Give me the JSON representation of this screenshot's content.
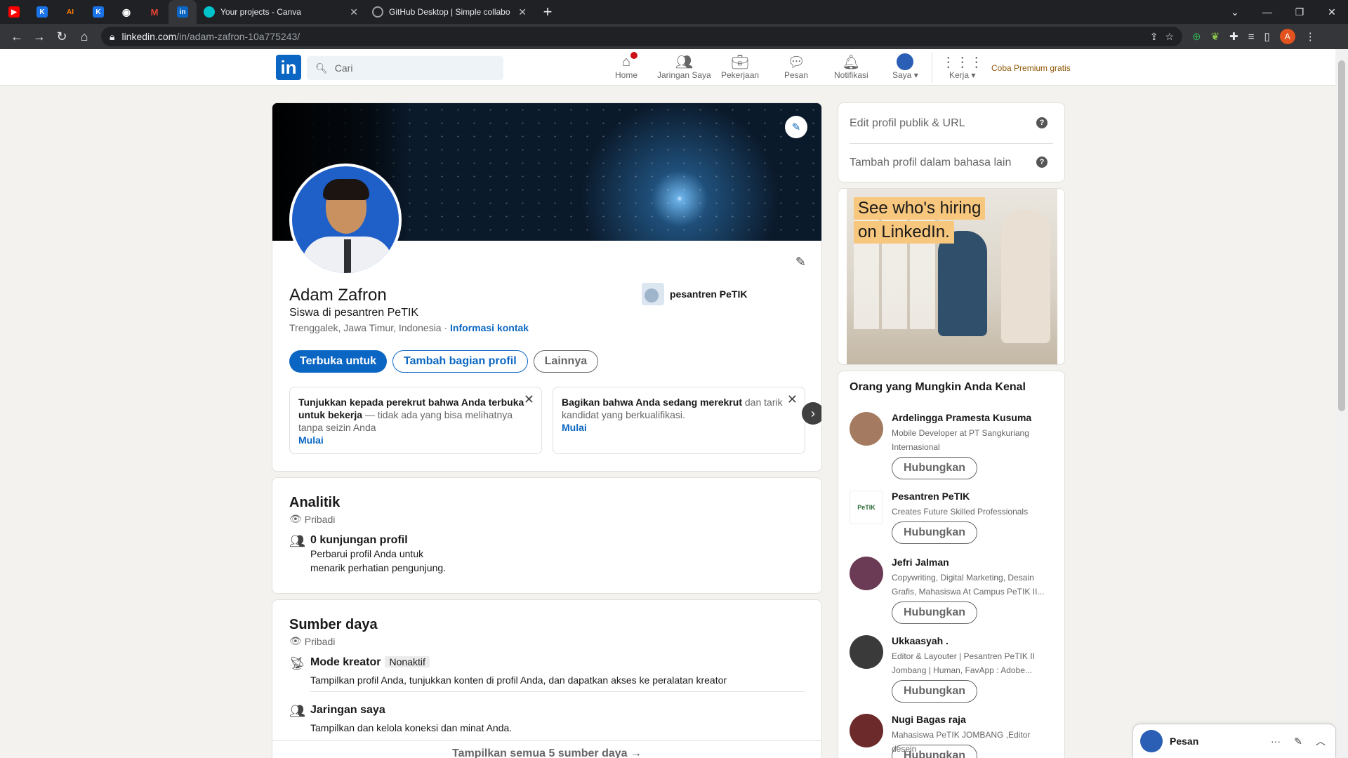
{
  "browser": {
    "pinned_tabs": [
      {
        "icon": "youtube-icon",
        "color": "#ff0000",
        "glyph": "▶"
      },
      {
        "icon": "k-app-icon",
        "color": "#1a73e8",
        "glyph": "K"
      },
      {
        "icon": "ai-app-icon",
        "color": "#ff7c00",
        "glyph": "AI"
      },
      {
        "icon": "k-app-icon",
        "color": "#1a73e8",
        "glyph": "K"
      },
      {
        "icon": "github-icon",
        "color": "#ffffff",
        "glyph": "◉"
      },
      {
        "icon": "gmail-icon",
        "color": "#ea4335",
        "glyph": "M"
      },
      {
        "icon": "linkedin-icon",
        "color": "#0a66c2",
        "glyph": "in"
      }
    ],
    "tabs": [
      {
        "title": "Your projects - Canva",
        "active": true
      },
      {
        "title": "GitHub Desktop | Simple collabo",
        "active": false
      }
    ],
    "url_host": "linkedin.com",
    "url_path": "/in/adam-zafron-10a775243/",
    "profile_initial": "A"
  },
  "header": {
    "logo": "in",
    "search_placeholder": "Cari",
    "nav": [
      {
        "label": "Home",
        "icon": "home-icon"
      },
      {
        "label": "Jaringan Saya",
        "icon": "network-icon"
      },
      {
        "label": "Pekerjaan",
        "icon": "briefcase-icon"
      },
      {
        "label": "Pesan",
        "icon": "messaging-icon"
      },
      {
        "label": "Notifikasi",
        "icon": "bell-icon"
      },
      {
        "label": "Saya",
        "icon": "avatar-icon"
      },
      {
        "label": "Kerja",
        "icon": "grid-icon"
      }
    ],
    "premium": "Coba Premium gratis"
  },
  "profile": {
    "name": "Adam Zafron",
    "headline": "Siswa di pesantren PeTIK",
    "location": "Trenggalek, Jawa Timur, Indonesia · ",
    "contact_link": "Informasi kontak",
    "education": "pesantren PeTIK",
    "buttons": {
      "open_to": "Terbuka untuk",
      "add_section": "Tambah bagian profil",
      "more": "Lainnya"
    },
    "promos": [
      {
        "bold": "Tunjukkan kepada perekrut bahwa Anda terbuka untuk bekerja",
        "rest": " — tidak ada yang bisa melihatnya tanpa seizin Anda",
        "link": "Mulai"
      },
      {
        "bold": "Bagikan bahwa Anda sedang merekrut",
        "rest": " dan tarik kandidat yang berkualifikasi.",
        "link": "Mulai"
      }
    ]
  },
  "analytics": {
    "title": "Analitik",
    "privacy": "Pribadi",
    "item_title": "0 kunjungan profil",
    "item_desc_1": "Perbarui profil Anda untuk",
    "item_desc_2": "menarik perhatian pengunjung."
  },
  "resources": {
    "title": "Sumber daya",
    "privacy": "Pribadi",
    "creator_title": "Mode kreator",
    "creator_badge": "Nonaktif",
    "creator_desc": "Tampilkan profil Anda, tunjukkan konten di profil Anda, dan dapatkan akses ke peralatan kreator",
    "network_title": "Jaringan saya",
    "network_desc": "Tampilkan dan kelola koneksi dan minat Anda.",
    "show_all": "Tampilkan semua 5 sumber daya →"
  },
  "sidebar": {
    "edit_public": "Edit profil publik & URL",
    "add_language": "Tambah profil dalam bahasa lain",
    "help": "?",
    "ad_line1": "See who's hiring",
    "ad_line2": "on LinkedIn.",
    "pymk_title": "Orang yang Mungkin Anda Kenal",
    "connect_label": "Hubungkan",
    "people": [
      {
        "name": "Ardelingga Pramesta Kusuma",
        "desc": "Mobile Developer at PT Sangkuriang Internasional"
      },
      {
        "name": "Pesantren PeTIK",
        "desc": "Creates Future Skilled Professionals",
        "logo": "PeTIK"
      },
      {
        "name": "Jefri Jalman",
        "desc": "Copywriting, Digital Marketing, Desain Grafis, Mahasiswa At Campus PeTIK II..."
      },
      {
        "name": "Ukkaasyah .",
        "desc": "Editor & Layouter | Pesantren PeTIK II Jombang | Human, FavApp : Adobe..."
      },
      {
        "name": "Nugi Bagas raja",
        "desc": "Mahasiswa PeTIK JOMBANG ,Editor desein"
      }
    ]
  },
  "messaging": {
    "label": "Pesan"
  }
}
